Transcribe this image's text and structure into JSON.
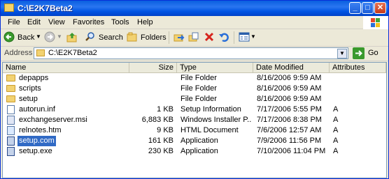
{
  "window": {
    "title": "C:\\E2K7Beta2",
    "colors": {
      "titlebar": "#0054e3",
      "selection": "#316ac5",
      "close": "#c4391b"
    }
  },
  "menu": [
    "File",
    "Edit",
    "View",
    "Favorites",
    "Tools",
    "Help"
  ],
  "toolbar": {
    "back_label": "Back",
    "search_label": "Search",
    "folders_label": "Folders"
  },
  "address": {
    "label": "Address",
    "value": "C:\\E2K7Beta2",
    "go_label": "Go"
  },
  "columns": [
    "Name",
    "Size",
    "Type",
    "Date Modified",
    "Attributes"
  ],
  "files": [
    {
      "name": "depapps",
      "size": "",
      "type": "File Folder",
      "date": "8/16/2006 9:59 AM",
      "attr": "",
      "icon": "folder-icon"
    },
    {
      "name": "scripts",
      "size": "",
      "type": "File Folder",
      "date": "8/16/2006 9:59 AM",
      "attr": "",
      "icon": "folder-icon"
    },
    {
      "name": "setup",
      "size": "",
      "type": "File Folder",
      "date": "8/16/2006 9:59 AM",
      "attr": "",
      "icon": "folder-icon"
    },
    {
      "name": "autorun.inf",
      "size": "1 KB",
      "type": "Setup Information",
      "date": "7/17/2006 5:55 PM",
      "attr": "A",
      "icon": "settings-file-icon"
    },
    {
      "name": "exchangeserver.msi",
      "size": "6,883 KB",
      "type": "Windows Installer P...",
      "date": "7/17/2006 8:38 PM",
      "attr": "A",
      "icon": "installer-icon"
    },
    {
      "name": "relnotes.htm",
      "size": "9 KB",
      "type": "HTML Document",
      "date": "7/6/2006 12:57 AM",
      "attr": "A",
      "icon": "html-document-icon"
    },
    {
      "name": "setup.com",
      "size": "161 KB",
      "type": "Application",
      "date": "7/9/2006 11:56 PM",
      "attr": "A",
      "icon": "application-icon"
    },
    {
      "name": "setup.exe",
      "size": "230 KB",
      "type": "Application",
      "date": "7/10/2006 11:04 PM",
      "attr": "A",
      "icon": "application-icon"
    }
  ],
  "selected_file": "setup.com"
}
